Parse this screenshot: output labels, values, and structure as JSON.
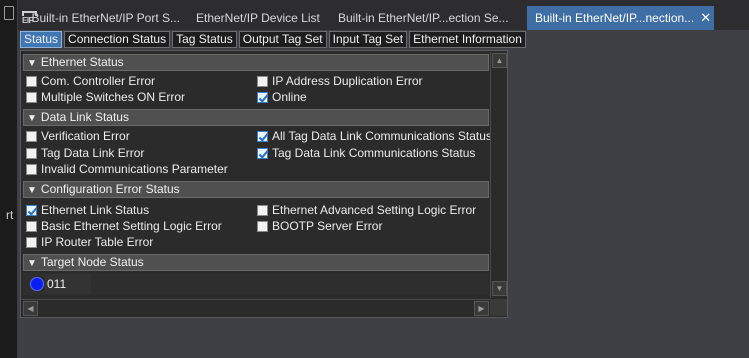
{
  "window": {
    "left_fragment": "rt"
  },
  "doc_tabs": [
    {
      "label": "Built-in EtherNet/IP Port S...",
      "icon": "eip-icon",
      "icon_text": "EIP"
    },
    {
      "label": "EtherNet/IP Device List"
    },
    {
      "label": "Built-in EtherNet/IP...ection Se..."
    },
    {
      "label": "Built-in EtherNet/IP...nection...",
      "active": true,
      "close": "✕"
    }
  ],
  "inner_tabs": [
    {
      "label": "Status",
      "active": true
    },
    {
      "label": "Connection Status"
    },
    {
      "label": "Tag Status"
    },
    {
      "label": "Output Tag Set"
    },
    {
      "label": "Input Tag Set"
    },
    {
      "label": "Ethernet Information"
    }
  ],
  "sections": {
    "ethernet_status": {
      "title": "Ethernet Status",
      "items": [
        {
          "label": "Com. Controller Error",
          "checked": false
        },
        {
          "label": "IP Address Duplication Error",
          "checked": false
        },
        {
          "label": "Multiple Switches ON Error",
          "checked": false
        },
        {
          "label": "Online",
          "checked": true
        }
      ]
    },
    "data_link_status": {
      "title": "Data Link Status",
      "items": [
        {
          "label": "Verification Error",
          "checked": false
        },
        {
          "label": "All Tag Data Link Communications Status",
          "checked": true
        },
        {
          "label": "Tag Data Link Error",
          "checked": false
        },
        {
          "label": "Tag Data Link Communications Status",
          "checked": true
        },
        {
          "label": "Invalid Communications Parameter",
          "checked": false
        }
      ]
    },
    "config_error_status": {
      "title": "Configuration Error Status",
      "items": [
        {
          "label": "Ethernet Link Status",
          "checked": true
        },
        {
          "label": "Ethernet Advanced Setting Logic Error",
          "checked": false
        },
        {
          "label": "Basic Ethernet Setting Logic Error",
          "checked": false
        },
        {
          "label": "BOOTP Server Error",
          "checked": false
        },
        {
          "label": "IP Router Table Error",
          "checked": false
        }
      ]
    },
    "target_node_status": {
      "title": "Target Node Status",
      "node": {
        "label": "011",
        "status_color": "#0a1ef0"
      }
    }
  },
  "colors": {
    "accent": "#3e6ea3",
    "checked_blue": "#2a6fc0"
  }
}
